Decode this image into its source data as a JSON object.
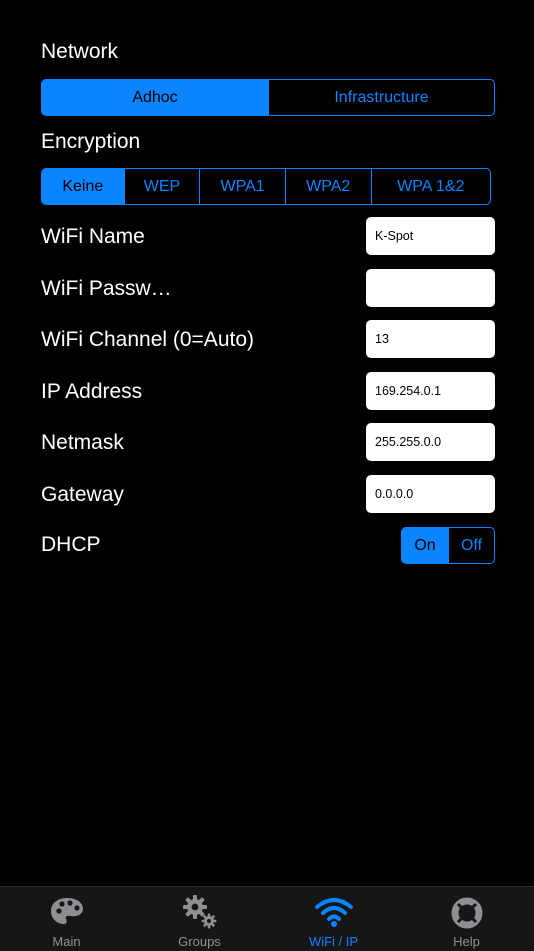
{
  "network": {
    "label": "Network",
    "options": [
      "Adhoc",
      "Infrastructure"
    ],
    "selected": "Adhoc"
  },
  "encryption": {
    "label": "Encryption",
    "options": [
      "Keine",
      "WEP",
      "WPA1",
      "WPA2",
      "WPA 1&2"
    ],
    "selected": "Keine"
  },
  "fields": {
    "wifi_name": {
      "label": "WiFi Name",
      "value": "K-Spot"
    },
    "wifi_password": {
      "label": "WiFi Passw…",
      "value": ""
    },
    "wifi_channel": {
      "label": "WiFi Channel (0=Auto)",
      "value": "13"
    },
    "ip_address": {
      "label": "IP Address",
      "value": "169.254.0.1"
    },
    "netmask": {
      "label": "Netmask",
      "value": "255.255.0.0"
    },
    "gateway": {
      "label": "Gateway",
      "value": "0.0.0.0"
    }
  },
  "dhcp": {
    "label": "DHCP",
    "options": [
      "On",
      "Off"
    ],
    "selected": "On"
  },
  "tabbar": {
    "tabs": [
      {
        "label": "Main",
        "icon": "palette-icon"
      },
      {
        "label": "Groups",
        "icon": "gears-icon"
      },
      {
        "label": "WiFi / IP",
        "icon": "wifi-icon"
      },
      {
        "label": "Help",
        "icon": "lifebuoy-icon"
      }
    ],
    "active": "WiFi / IP"
  },
  "colors": {
    "accent": "#0a84ff",
    "background": "#000000",
    "tabbar_bg": "#161616",
    "inactive_tab": "#8e8e93"
  }
}
